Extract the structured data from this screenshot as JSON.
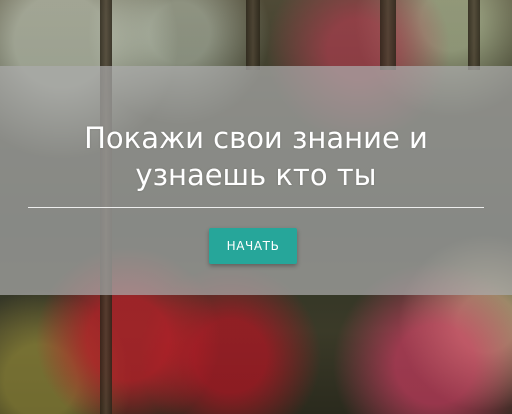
{
  "hero": {
    "title_line1": "Покажи свои знание и",
    "title_line2": "узнаешь кто ты",
    "start_button": "НАЧАТЬ"
  },
  "colors": {
    "overlay": "#aaaaaa",
    "button": "#26a69a",
    "text": "#ffffff"
  }
}
